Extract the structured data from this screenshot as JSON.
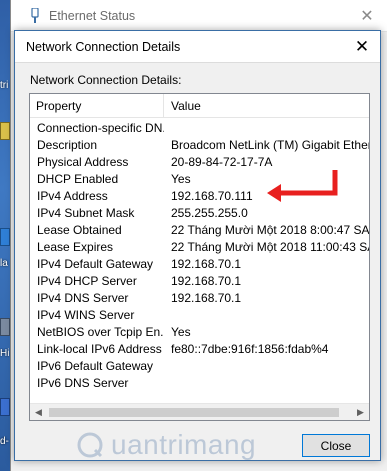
{
  "desktop": {
    "labels": [
      "tri",
      "la",
      "Hi",
      "d-"
    ]
  },
  "back_window": {
    "title": "Ethernet Status",
    "close_glyph": "✕"
  },
  "dialog": {
    "title": "Network Connection Details",
    "close_glyph": "✕",
    "caption": "Network Connection Details:",
    "columns": {
      "property": "Property",
      "value": "Value"
    },
    "rows": [
      {
        "property": "Connection-specific DN...",
        "value": ""
      },
      {
        "property": "Description",
        "value": "Broadcom NetLink (TM) Gigabit Ethernet"
      },
      {
        "property": "Physical Address",
        "value": "20-89-84-72-17-7A"
      },
      {
        "property": "DHCP Enabled",
        "value": "Yes"
      },
      {
        "property": "IPv4 Address",
        "value": "192.168.70.111"
      },
      {
        "property": "IPv4 Subnet Mask",
        "value": "255.255.255.0"
      },
      {
        "property": "Lease Obtained",
        "value": "22 Tháng Mười Một 2018 8:00:47 SA"
      },
      {
        "property": "Lease Expires",
        "value": "22 Tháng Mười Một 2018 11:00:43 SA"
      },
      {
        "property": "IPv4 Default Gateway",
        "value": "192.168.70.1"
      },
      {
        "property": "IPv4 DHCP Server",
        "value": "192.168.70.1"
      },
      {
        "property": "IPv4 DNS Server",
        "value": "192.168.70.1"
      },
      {
        "property": "IPv4 WINS Server",
        "value": ""
      },
      {
        "property": "NetBIOS over Tcpip En...",
        "value": "Yes"
      },
      {
        "property": "Link-local IPv6 Address",
        "value": "fe80::7dbe:916f:1856:fdab%4"
      },
      {
        "property": "IPv6 Default Gateway",
        "value": ""
      },
      {
        "property": "IPv6 DNS Server",
        "value": ""
      }
    ],
    "close_button": "Close",
    "annotation_color": "#e8201f"
  },
  "watermark": {
    "text": "uantrimang"
  }
}
